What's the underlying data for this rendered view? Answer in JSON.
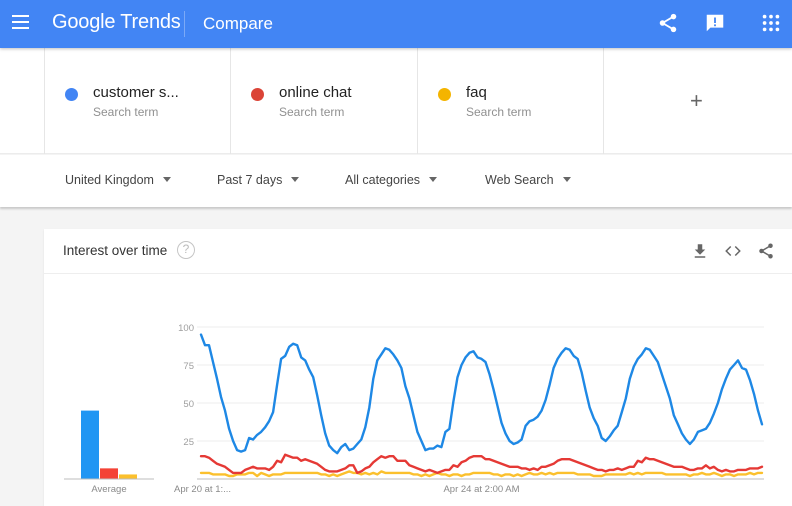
{
  "header": {
    "app_name": "Google Trends",
    "page_title": "Compare",
    "icons": [
      "menu-icon",
      "share-icon",
      "feedback-icon",
      "apps-icon"
    ]
  },
  "terms": [
    {
      "name": "customer s...",
      "type": "Search term",
      "color": "#4285f4"
    },
    {
      "name": "online chat",
      "type": "Search term",
      "color": "#db4437"
    },
    {
      "name": "faq",
      "type": "Search term",
      "color": "#f4b400"
    }
  ],
  "add_term_label": "+",
  "filters": [
    {
      "label": "United Kingdom"
    },
    {
      "label": "Past 7 days"
    },
    {
      "label": "All categories"
    },
    {
      "label": "Web Search"
    }
  ],
  "card": {
    "title": "Interest over time",
    "help_label": "?",
    "actions": [
      "download-icon",
      "embed-icon",
      "share-icon"
    ]
  },
  "chart_data": {
    "type": "line",
    "title": "Interest over time",
    "xlabel": "",
    "ylabel": "",
    "ylim": [
      0,
      100
    ],
    "yticks": [
      25,
      50,
      75,
      100
    ],
    "grid": true,
    "x_tick_labels": [
      {
        "label": "Apr 20 at 1:...",
        "index": 0
      },
      {
        "label": "Apr 24 at 2:00 AM",
        "index": 70
      }
    ],
    "average": {
      "label": "Average",
      "values": [
        45,
        7,
        3
      ]
    },
    "series": [
      {
        "name": "customer s...",
        "color": "#1e88e5",
        "values": [
          95,
          88,
          88,
          77,
          66,
          54,
          45,
          33,
          25,
          19,
          18,
          19,
          27,
          26,
          29,
          31,
          34,
          38,
          44,
          62,
          79,
          81,
          87,
          89,
          88,
          80,
          78,
          72,
          67,
          55,
          42,
          30,
          22,
          19,
          17,
          21,
          23,
          19,
          20,
          23,
          26,
          34,
          47,
          66,
          78,
          82,
          86,
          85,
          82,
          78,
          73,
          61,
          53,
          42,
          31,
          25,
          19,
          20,
          20,
          22,
          21,
          31,
          33,
          51,
          67,
          75,
          80,
          83,
          84,
          80,
          79,
          77,
          69,
          59,
          48,
          37,
          30,
          25,
          23,
          24,
          26,
          35,
          38,
          39,
          41,
          45,
          52,
          62,
          73,
          79,
          83,
          86,
          85,
          81,
          79,
          70,
          58,
          47,
          40,
          35,
          27,
          25,
          28,
          32,
          35,
          44,
          53,
          66,
          74,
          79,
          82,
          86,
          85,
          81,
          77,
          69,
          61,
          53,
          42,
          36,
          30,
          26,
          23,
          26,
          31,
          32,
          33,
          37,
          43,
          50,
          59,
          66,
          72,
          75,
          78,
          73,
          72,
          65,
          56,
          45,
          36
        ]
      },
      {
        "name": "online chat",
        "color": "#e53935",
        "values": [
          15,
          15,
          14,
          12,
          10,
          9,
          8,
          6,
          4,
          4,
          4,
          6,
          7,
          8,
          7,
          7,
          7,
          6,
          8,
          12,
          11,
          16,
          15,
          14,
          14,
          12,
          13,
          12,
          11,
          10,
          8,
          6,
          5,
          5,
          5,
          6,
          7,
          9,
          9,
          4,
          5,
          7,
          8,
          11,
          13,
          15,
          14,
          15,
          15,
          12,
          12,
          12,
          9,
          8,
          7,
          6,
          5,
          6,
          5,
          4,
          5,
          6,
          6,
          9,
          8,
          11,
          12,
          14,
          15,
          15,
          15,
          13,
          13,
          12,
          11,
          10,
          9,
          8,
          8,
          8,
          7,
          7,
          6,
          7,
          6,
          8,
          8,
          9,
          10,
          12,
          13,
          13,
          13,
          12,
          11,
          10,
          9,
          8,
          7,
          6,
          6,
          5,
          6,
          6,
          7,
          6,
          7,
          8,
          8,
          12,
          11,
          14,
          13,
          13,
          12,
          11,
          10,
          9,
          8,
          8,
          8,
          7,
          6,
          6,
          7,
          7,
          9,
          7,
          8,
          6,
          5,
          6,
          5,
          5,
          6,
          6,
          6,
          7,
          7,
          7,
          8
        ]
      },
      {
        "name": "faq",
        "color": "#fbc02d",
        "values": [
          4,
          4,
          4,
          3,
          3,
          3,
          3,
          2,
          2,
          3,
          3,
          3,
          4,
          4,
          2,
          4,
          3,
          2,
          3,
          3,
          3,
          4,
          4,
          4,
          4,
          4,
          4,
          4,
          4,
          4,
          3,
          3,
          2,
          3,
          2,
          3,
          4,
          5,
          4,
          4,
          3,
          4,
          3,
          4,
          3,
          5,
          4,
          4,
          4,
          4,
          4,
          4,
          4,
          3,
          3,
          2,
          3,
          2,
          3,
          4,
          3,
          3,
          2,
          3,
          3,
          2,
          3,
          3,
          4,
          4,
          4,
          4,
          4,
          3,
          3,
          2,
          3,
          3,
          2,
          3,
          2,
          3,
          4,
          3,
          3,
          4,
          3,
          4,
          3,
          4,
          4,
          4,
          4,
          4,
          3,
          3,
          3,
          3,
          2,
          2,
          2,
          3,
          3,
          3,
          3,
          3,
          3,
          4,
          3,
          4,
          3,
          4,
          4,
          4,
          4,
          4,
          3,
          3,
          3,
          3,
          3,
          3,
          2,
          3,
          3,
          4,
          3,
          3,
          4,
          3,
          2,
          3,
          3,
          2,
          3,
          3,
          3,
          4,
          3,
          4,
          4
        ]
      }
    ]
  }
}
